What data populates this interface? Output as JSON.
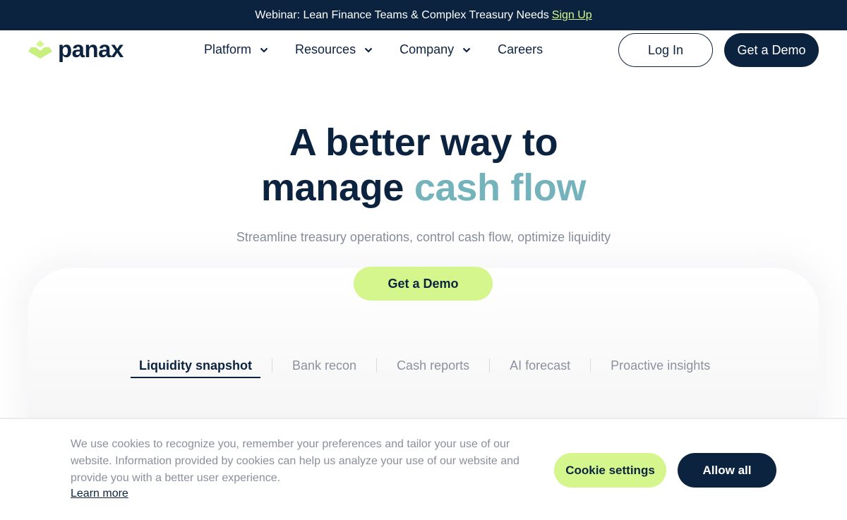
{
  "announcement": {
    "text": "Webinar: Lean Finance Teams & Complex Treasury Needs",
    "link_label": "Sign Up"
  },
  "brand": {
    "name": "panax",
    "logo_icon": "stacked-chevron-logo-icon",
    "colors": {
      "navy": "#0c2340",
      "lime": "#d4f68c",
      "teal_accent": "#74b3bb",
      "muted_text": "#868c99"
    }
  },
  "nav": {
    "items": [
      {
        "label": "Platform",
        "has_dropdown": true
      },
      {
        "label": "Resources",
        "has_dropdown": true
      },
      {
        "label": "Company",
        "has_dropdown": true
      },
      {
        "label": "Careers",
        "has_dropdown": false
      }
    ],
    "login_label": "Log In",
    "demo_label": "Get a Demo"
  },
  "hero": {
    "title_line1": "A better way to",
    "title_line2_plain": "manage",
    "title_line2_accent": "cash flow",
    "subtitle": "Streamline treasury operations, control cash flow, optimize liquidity",
    "cta_label": "Get a Demo"
  },
  "tabs": [
    {
      "label": "Liquidity snapshot",
      "active": true
    },
    {
      "label": "Bank recon",
      "active": false
    },
    {
      "label": "Cash reports",
      "active": false
    },
    {
      "label": "AI forecast",
      "active": false
    },
    {
      "label": "Proactive insights",
      "active": false
    }
  ],
  "cookie_banner": {
    "text": "We use cookies to recognize you, remember your preferences and tailor your use of our website. Information provided by cookies can help us analyze your use of our website and provide you with a better user experience.",
    "learn_more_label": "Learn more",
    "settings_label": "Cookie settings",
    "allow_label": "Allow all"
  }
}
